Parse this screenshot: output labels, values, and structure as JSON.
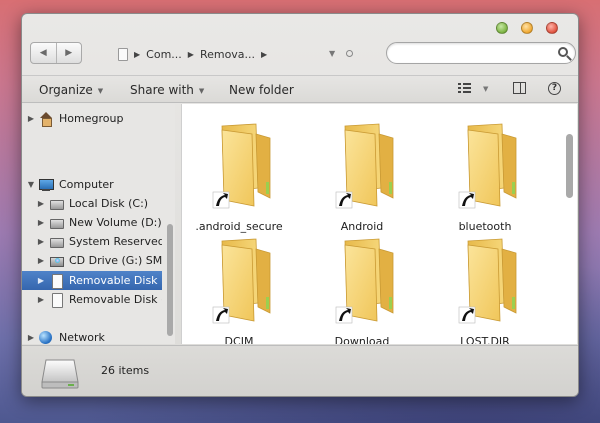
{
  "window": {
    "breadcrumb": [
      "Com...",
      "Remova..."
    ],
    "search_placeholder": ""
  },
  "toolbar": {
    "organize_label": "Organize",
    "share_label": "Share with",
    "new_folder_label": "New folder"
  },
  "sidebar": {
    "items": [
      {
        "label": "Homegroup",
        "icon": "homegroup-icon",
        "level": 0,
        "selected": false
      },
      {
        "label": "Computer",
        "icon": "computer-icon",
        "level": 0,
        "selected": false,
        "expanded": true
      },
      {
        "label": "Local Disk (C:)",
        "icon": "hard-disk-icon",
        "level": 1,
        "selected": false
      },
      {
        "label": "New Volume (D:)",
        "icon": "hard-disk-icon",
        "level": 1,
        "selected": false
      },
      {
        "label": "System Reserved",
        "icon": "hard-disk-icon",
        "level": 1,
        "selected": false
      },
      {
        "label": "CD Drive (G:) SMA",
        "icon": "cd-drive-icon",
        "level": 1,
        "selected": false
      },
      {
        "label": "Removable Disk",
        "icon": "removable-disk-icon",
        "level": 1,
        "selected": true
      },
      {
        "label": "Removable Disk (",
        "icon": "removable-disk-icon",
        "level": 1,
        "selected": false
      },
      {
        "label": "Network",
        "icon": "network-icon",
        "level": 0,
        "selected": false
      }
    ]
  },
  "content": {
    "folders": [
      {
        "name": ".android_secure"
      },
      {
        "name": "Android"
      },
      {
        "name": "bluetooth"
      },
      {
        "name": "DCIM"
      },
      {
        "name": "Download"
      },
      {
        "name": "LOST.DIR"
      }
    ]
  },
  "status": {
    "item_count": "26 items"
  },
  "colors": {
    "selection": "#3a6db3",
    "folder": "#f2cf63"
  }
}
